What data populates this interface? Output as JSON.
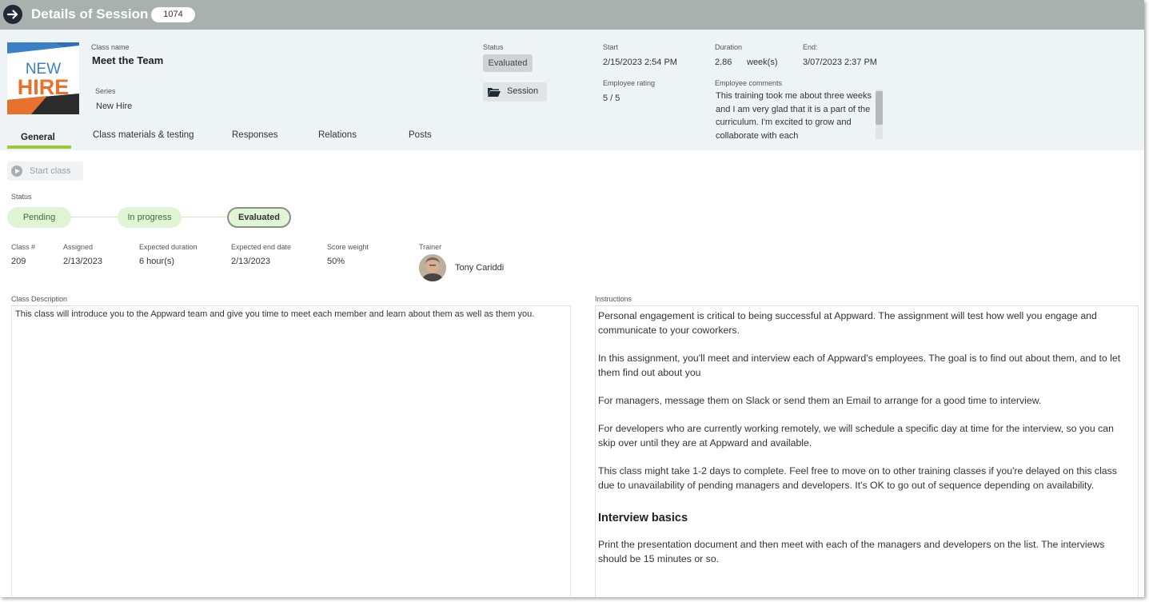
{
  "window": {
    "title": "Details of Session",
    "session_id": "1074"
  },
  "logo": {
    "line1": "NEW",
    "line2": "HIRE"
  },
  "class": {
    "name_label": "Class name",
    "name": "Meet the Team",
    "series_label": "Series",
    "series": "New Hire"
  },
  "status": {
    "label": "Status",
    "value": "Evaluated",
    "session_button": "Session"
  },
  "schedule": {
    "start_label": "Start",
    "start": "2/15/2023 2:54 PM",
    "duration_label": "Duration",
    "duration_value": "2.86",
    "duration_unit": "week(s)",
    "end_label": "End:",
    "end": "3/07/2023 2:37 PM"
  },
  "rating": {
    "label": "Employee rating",
    "value": "5 / 5"
  },
  "comments": {
    "label": "Employee comments",
    "text": "This training took me about three weeks and I am very glad that it is a part of the curriculum. I'm excited to grow and collaborate with each"
  },
  "tabs": [
    {
      "label": "General",
      "active": true
    },
    {
      "label": "Class materials & testing",
      "active": false
    },
    {
      "label": "Responses",
      "active": false
    },
    {
      "label": "Relations",
      "active": false
    },
    {
      "label": "Posts",
      "active": false
    }
  ],
  "actions": {
    "start_class": "Start class"
  },
  "progress": {
    "label": "Status",
    "steps": [
      "Pending",
      "In progress",
      "Evaluated"
    ],
    "current_step": "Evaluated"
  },
  "details": {
    "class_num_label": "Class #",
    "class_num": "209",
    "assigned_label": "Assigned",
    "assigned": "2/13/2023",
    "exp_duration_label": "Expected duration",
    "exp_duration": "6 hour(s)",
    "exp_end_label": "Expected end date",
    "exp_end": "2/13/2023",
    "score_weight_label": "Score weight",
    "score_weight": "50%",
    "trainer_label": "Trainer",
    "trainer": "Tony Cariddi"
  },
  "description": {
    "label": "Class Description",
    "text": "This class will introduce you to the Appward team and give you time to meet each member and learn about them as well as them you."
  },
  "instructions": {
    "label": "Instructions",
    "p1": "Personal engagement is critical to being successful at Appward. The assignment will test how well you engage and communicate to your coworkers.",
    "p2": "In this assignment, you'll meet and interview each of Appward's employees. The goal is to find out about them, and to let them find out about you",
    "p3": "For managers, message them on Slack or send them an Email to arrange for a good time to interview.",
    "p4": "For developers who are currently working remotely, we will schedule a specific day at time for the interview, so you can skip over until they are at Appward and available.",
    "p5": "This class might take 1-2 days to complete. Feel free to move on to other training classes if you're delayed on this class due to unavailability of pending managers and developers. It's OK to go out of sequence depending on availability.",
    "heading": "Interview basics",
    "p6": "Print the presentation document and then meet with each of the managers and developers on the list. The interviews should be 15 minutes or so."
  },
  "colors": {
    "titlebar": "#a9b1ae",
    "header_bg": "#eef3f6",
    "accent_green": "#99cc33",
    "step_green": "#dff5d3",
    "logo_orange": "#e8712e",
    "logo_blue": "#3b7fc4"
  }
}
